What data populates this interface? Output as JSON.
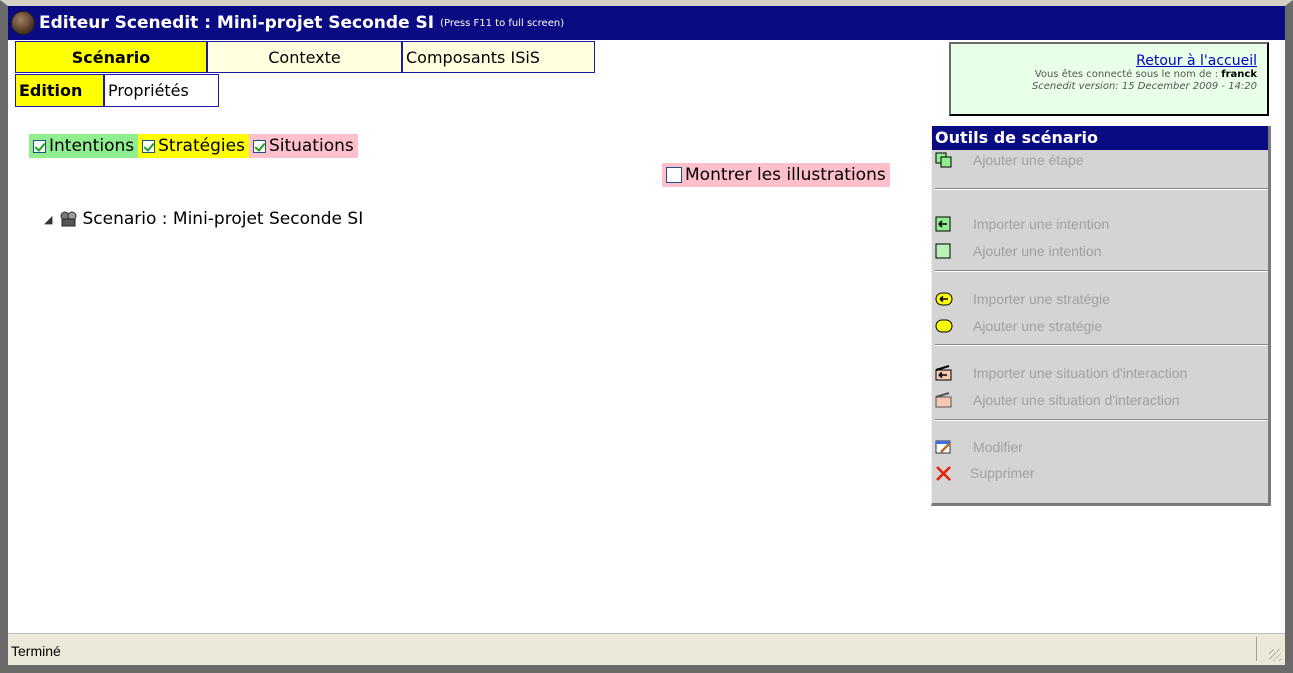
{
  "window": {
    "title": "Editeur Scenedit : Mini-projet Seconde SI",
    "hint": "(Press F11 to full screen)"
  },
  "tabs": {
    "main": [
      "Scénario",
      "Contexte",
      "Composants ISiS"
    ],
    "sub": [
      "Edition",
      "Propriétés"
    ]
  },
  "user": {
    "home_link": "Retour à l'accueil",
    "connected_prefix": "Vous êtes connecté sous le nom de : ",
    "username": "franck",
    "version": "Scenedit version: 15 December 2009 - 14:20"
  },
  "filters": {
    "intentions": {
      "label": "Intentions",
      "checked": true,
      "color": "#90ee90"
    },
    "strategies": {
      "label": "Stratégies",
      "checked": true,
      "color": "#ffff00"
    },
    "situations": {
      "label": "Situations",
      "checked": true,
      "color": "#ffc0cb"
    },
    "illustrations": {
      "label": "Montrer les illustrations",
      "checked": false,
      "color": "#ffc0cb"
    }
  },
  "tree": {
    "root_label": "Scenario : Mini-projet Seconde SI"
  },
  "tools": {
    "title": "Outils de scénario",
    "items": [
      {
        "label": "Ajouter une étape",
        "icon": "add-step-icon"
      },
      {
        "label": "Importer une intention",
        "icon": "import-intention-icon"
      },
      {
        "label": "Ajouter une intention",
        "icon": "add-intention-icon"
      },
      {
        "label": "Importer une stratégie",
        "icon": "import-strategy-icon"
      },
      {
        "label": "Ajouter une stratégie",
        "icon": "add-strategy-icon"
      },
      {
        "label": "Importer une situation d'interaction",
        "icon": "import-situation-icon"
      },
      {
        "label": "Ajouter une situation d'interaction",
        "icon": "add-situation-icon"
      },
      {
        "label": "Modifier",
        "icon": "edit-icon"
      },
      {
        "label": "Supprimer",
        "icon": "delete-icon"
      }
    ]
  },
  "status": {
    "text": "Terminé"
  }
}
